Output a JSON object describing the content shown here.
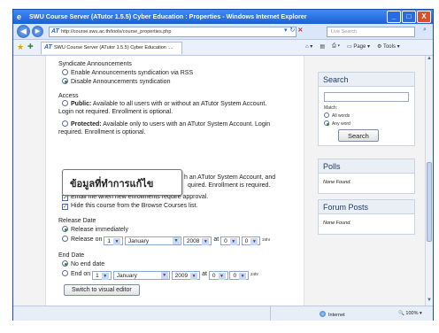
{
  "window": {
    "title": "SWU Course Server (ATutor 1.5.5) Cyber Education : Properties - Windows Internet Explorer",
    "minimize": "_",
    "maximize": "□",
    "close": "X"
  },
  "browser": {
    "url": "http://course.swu.ac.th/tools/course_properties.php",
    "search_placeholder": "Live Search",
    "tab_title": "SWU Course Server (ATutor 1.5.5) Cyber Education :...",
    "page_menu": "Page",
    "tools_menu": "Tools"
  },
  "form": {
    "syndicate": {
      "heading": "Syndicate Announcements",
      "options": [
        "Enable Announcements syndication via RSS",
        "Disable Announcements syndication"
      ],
      "selected": 1
    },
    "access": {
      "heading": "Access",
      "public_label": "Public:",
      "public_text": "Available to all users with or without an ATutor System Account.",
      "public_text2": "Login not required. Enrollment is optional.",
      "protected_label": "Protected:",
      "protected_text": "Available only to users with an ATutor System Account. Login",
      "protected_text2": "required. Enrollment is optional.",
      "private_text": "h an ATutor System Account, and",
      "private_text2": "quired. Enrollment is required.",
      "email_notify": "Email me when new enrollments require approval.",
      "hide_course": "Hide this course from the Browse Courses list."
    },
    "release": {
      "heading": "Release Date",
      "immediately": "Release immediately",
      "release_on": "Release on",
      "day": "1",
      "month": "January",
      "year": "2008",
      "at": "at",
      "hour": "0",
      "minute": "0",
      "hr_label": "24hr"
    },
    "end": {
      "heading": "End Date",
      "no_end": "No end date",
      "end_on": "End on",
      "day": "1",
      "month": "January",
      "year": "2009",
      "at": "at",
      "hour": "0",
      "minute": "0",
      "hr_label": "24hr"
    },
    "switch_button": "Switch to visual editor"
  },
  "overlay": {
    "text": "ข้อมูลที่ทำการแก้ไข"
  },
  "sidebar": {
    "search": {
      "title": "Search",
      "match_label": "Match:",
      "all_words": "All words",
      "any_word": "Any word",
      "button": "Search"
    },
    "polls": {
      "title": "Polls",
      "none": "None Found."
    },
    "forum": {
      "title": "Forum Posts",
      "none": "None Found."
    }
  },
  "status": {
    "zone": "Internet",
    "zoom": "100%"
  }
}
